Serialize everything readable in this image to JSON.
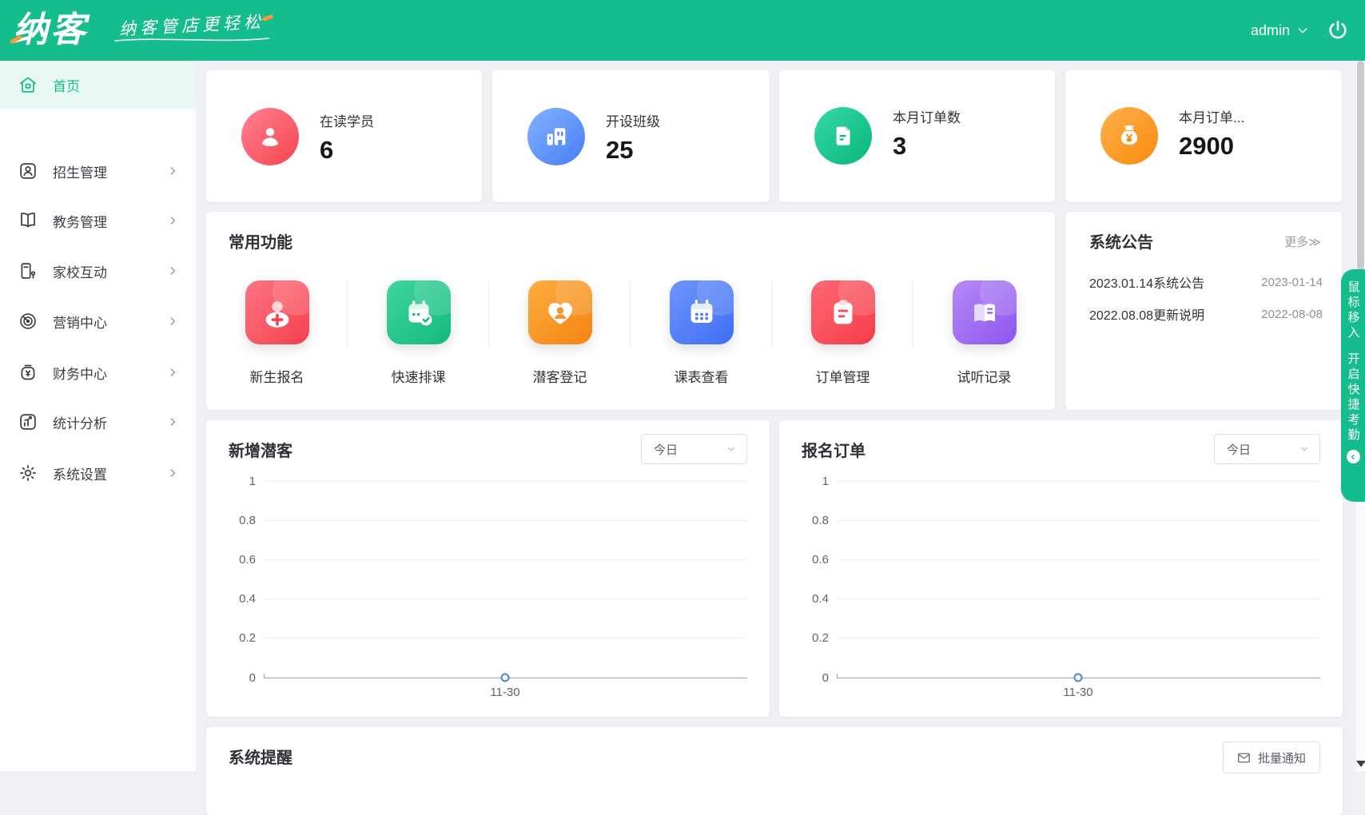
{
  "header": {
    "logo_text": "纳客",
    "logo_tagline": "纳客管店更轻松",
    "username": "admin"
  },
  "sidebar": {
    "items": [
      {
        "label": "首页",
        "active": true
      },
      {
        "label": "招生管理",
        "active": false
      },
      {
        "label": "教务管理",
        "active": false
      },
      {
        "label": "家校互动",
        "active": false
      },
      {
        "label": "营销中心",
        "active": false
      },
      {
        "label": "财务中心",
        "active": false
      },
      {
        "label": "统计分析",
        "active": false
      },
      {
        "label": "系统设置",
        "active": false
      }
    ]
  },
  "stats": {
    "cards": [
      {
        "label": "在读学员",
        "value": "6",
        "icon": "user-icon",
        "color": "#f6454f"
      },
      {
        "label": "开设班级",
        "value": "25",
        "icon": "building-icon",
        "color": "#477ef7"
      },
      {
        "label": "本月订单数",
        "value": "3",
        "icon": "document-icon",
        "color": "#0ab67e"
      },
      {
        "label": "本月订单...",
        "value": "2900",
        "icon": "money-bag-icon",
        "color": "#f78a0c"
      }
    ]
  },
  "quick_functions": {
    "title": "常用功能",
    "items": [
      {
        "label": "新生报名",
        "icon": "student-add-icon",
        "color": "#f6404e"
      },
      {
        "label": "快速排课",
        "icon": "calendar-check-icon",
        "color": "#14b97e"
      },
      {
        "label": "潜客登记",
        "icon": "heart-user-icon",
        "color": "#f58312"
      },
      {
        "label": "课表查看",
        "icon": "calendar-grid-icon",
        "color": "#3e6df4"
      },
      {
        "label": "订单管理",
        "icon": "clipboard-icon",
        "color": "#f63b49"
      },
      {
        "label": "试听记录",
        "icon": "open-book-icon",
        "color": "#8d55ee"
      }
    ]
  },
  "announcements": {
    "title": "系统公告",
    "more_label": "更多≫",
    "items": [
      {
        "title": "2023.01.14系统公告",
        "date": "2023-01-14"
      },
      {
        "title": "2022.08.08更新说明",
        "date": "2022-08-08"
      }
    ]
  },
  "charts": [
    {
      "title": "新增潜客",
      "range_label": "今日",
      "yticks": [
        "1",
        "0.8",
        "0.6",
        "0.4",
        "0.2",
        "0"
      ],
      "xtick": "11-30"
    },
    {
      "title": "报名订单",
      "range_label": "今日",
      "yticks": [
        "1",
        "0.8",
        "0.6",
        "0.4",
        "0.2",
        "0"
      ],
      "xtick": "11-30"
    }
  ],
  "chart_data": [
    {
      "type": "line",
      "title": "新增潜客",
      "range_selected": "今日",
      "x": [
        "11-30"
      ],
      "series": [
        {
          "name": "新增潜客",
          "values": [
            0
          ]
        }
      ],
      "ylim": [
        0,
        1
      ],
      "yticks": [
        0,
        0.2,
        0.4,
        0.6,
        0.8,
        1
      ],
      "grid": true,
      "legend": false,
      "marker": "circle",
      "marker_color": "#4a7ff0"
    },
    {
      "type": "line",
      "title": "报名订单",
      "range_selected": "今日",
      "x": [
        "11-30"
      ],
      "series": [
        {
          "name": "报名订单",
          "values": [
            0
          ]
        }
      ],
      "ylim": [
        0,
        1
      ],
      "yticks": [
        0,
        0.2,
        0.4,
        0.6,
        0.8,
        1
      ],
      "grid": true,
      "legend": false,
      "marker": "circle",
      "marker_color": "#4a7ff0"
    }
  ],
  "reminders": {
    "title": "系统提醒",
    "batch_button_label": "批量通知"
  },
  "side_widget": {
    "line1": "鼠标移入",
    "line2": "开启快捷考勤",
    "collapse_icon": "chevron-left-circle"
  },
  "icons": {
    "user_dropdown": "chevron-down",
    "logout": "power",
    "menu_expand": "chevron-right",
    "batch_notify": "envelope",
    "scroll_down": "triangle-down"
  },
  "colors": {
    "brand_green": "#15bd8c",
    "sidebar_active_bg": "#e9f8f2",
    "page_bg": "#eef0f4",
    "chart_point": "#4a7ff0"
  }
}
